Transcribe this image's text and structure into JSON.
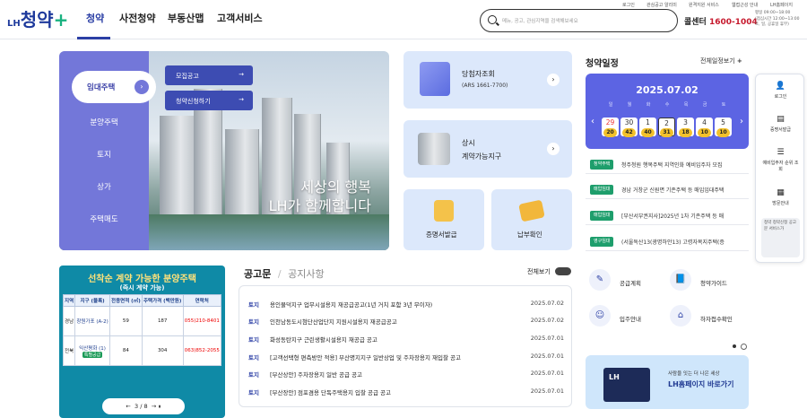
{
  "header": {
    "logo": {
      "lh": "LH",
      "name": "청약",
      "plus": "+"
    },
    "nav": [
      "청약",
      "사전청약",
      "부동산맵",
      "고객서비스"
    ],
    "utility": [
      "로그인",
      "관심공고 알리미",
      "원격지원 서비스",
      "웹접근성 안내",
      "LH홈페이지"
    ],
    "search_placeholder": "메뉴, 공고, 관심지역을 검색해보세요",
    "call_center_label": "콜센터",
    "call_center_number": "1600-1004",
    "hours": [
      "평일 09:00~18:00",
      "(점심시간 12:00~13:00",
      "토, 일, 공휴일 휴무)"
    ]
  },
  "menu": {
    "items": [
      "임대주택",
      "분양주택",
      "토지",
      "상가",
      "주택매도"
    ],
    "active_arrow": "›",
    "sub": [
      "모집공고",
      "청약신청하기"
    ],
    "sub_arrow": "→",
    "slogan": [
      "세상의 행복",
      "LH가 함께합니다"
    ]
  },
  "cards": {
    "winner": {
      "title": "당첨자조회",
      "sub": "(ARS 1661-7700)"
    },
    "district": {
      "title": "상시",
      "title2": "계약가능지구"
    },
    "cert": {
      "title": "증명서발급"
    },
    "payment": {
      "title": "납부확인"
    },
    "arrow": "›"
  },
  "schedule": {
    "title": "청약일정",
    "all": "전체일정보기",
    "plus": "+",
    "date": "2025.07.02",
    "dows": [
      "일",
      "월",
      "화",
      "수",
      "목",
      "금",
      "토"
    ],
    "days": [
      "29",
      "30",
      "1",
      "2",
      "3",
      "4",
      "5"
    ],
    "counts": [
      "20",
      "42",
      "40",
      "31",
      "18",
      "10",
      "10"
    ],
    "items": [
      {
        "tag": "청약주택",
        "text": "청주청원 행복주택 지역인화 예비입주자 모집"
      },
      {
        "tag": "매입임대",
        "text": "경남 거창군 신원면 기존주택 등 매입임대주택"
      },
      {
        "tag": "매입임대",
        "text": "[부산서부권지사]2025년 1차 기존주택 등 매"
      },
      {
        "tag": "영구임대",
        "text": "(서울독산13(광명하안13) 고령자복지주택(증"
      }
    ]
  },
  "right_quick": [
    {
      "icon": "👤",
      "label": "로그인"
    },
    {
      "icon": "▤",
      "label": "증명서발급"
    },
    {
      "icon": "☰",
      "label": "예비입주자 순위 조회"
    },
    {
      "icon": "▦",
      "label": "방문안내"
    },
    {
      "icon": "",
      "label": "청약 청약신청 공고문 서비스가"
    }
  ],
  "banner": {
    "title": "선착순 계약 가능한 분양주택",
    "subtitle": "(즉시 계약 가능)",
    "headers": [
      "지역",
      "지구 (블록)",
      "전용면적 (㎡)",
      "주택가격 (백만원)",
      "연락처"
    ],
    "rows": [
      {
        "region": "경남",
        "district": "창원가포 (A-2)",
        "area": "59",
        "price": "187",
        "phone": "055)210-8401",
        "badge": ""
      },
      {
        "region": "전북",
        "district": "익산평화 (1)",
        "area": "84",
        "price": "304",
        "phone": "063)852-2055",
        "badge": "특별공급"
      }
    ],
    "pager": {
      "prev": "←",
      "current": "3",
      "total": "8",
      "sep": "/",
      "next": "→",
      "pause": "⏸"
    }
  },
  "notices": {
    "tabs": [
      "공고문",
      "공지사항"
    ],
    "tab_sep": "/",
    "more": "전체보기",
    "rows": [
      {
        "cat": "토지",
        "title": "용인물덕지구 업무시설용지 재공급공고(1년 거치 포함 3년 무이자)",
        "date": "2025.07.02"
      },
      {
        "cat": "토지",
        "title": "인천남동도시첨단산업단지 지원시설용지 재공급공고",
        "date": "2025.07.02"
      },
      {
        "cat": "토지",
        "title": "화성동탄지구 근린생활시설용지 재공급 공고",
        "date": "2025.07.01"
      },
      {
        "cat": "토지",
        "title": "[고객선택형 편측방안 적용] 부산명지지구 일반상업 및 주차장용지 재입찰 공고",
        "date": "2025.07.01"
      },
      {
        "cat": "토지",
        "title": "[부산상안] 주차장용지 일반 공급 공고",
        "date": "2025.07.01"
      },
      {
        "cat": "토지",
        "title": "[부산장안] 점포겸용 단독주택용지 입찰 공급 공고",
        "date": "2025.07.01"
      }
    ]
  },
  "quick_links": [
    {
      "icon": "✎",
      "label": "공급계획"
    },
    {
      "icon": "📘",
      "label": "청약가이드"
    },
    {
      "icon": "☺",
      "label": "입주안내"
    },
    {
      "icon": "⌂",
      "label": "하자접수확인"
    }
  ],
  "lh_banner": {
    "badge": "LH",
    "small": "사람을 잇는 더 나은 세상",
    "link": "LH홈페이지 바로가기"
  }
}
